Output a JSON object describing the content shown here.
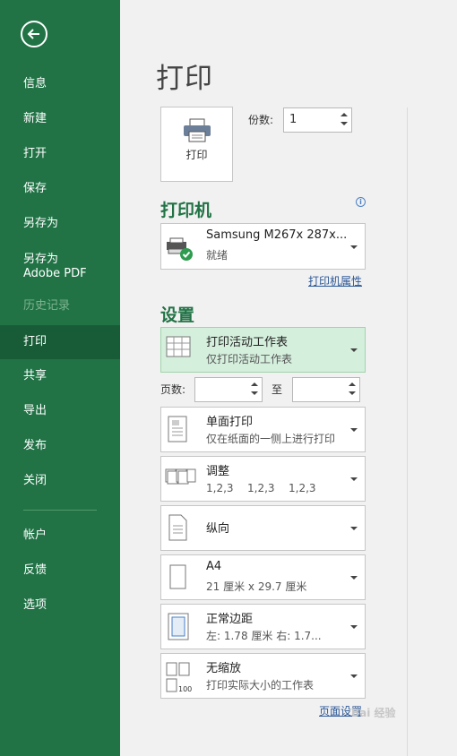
{
  "sidebar": {
    "items": [
      {
        "label": "信息",
        "state": "normal"
      },
      {
        "label": "新建",
        "state": "normal"
      },
      {
        "label": "打开",
        "state": "normal"
      },
      {
        "label": "保存",
        "state": "normal"
      },
      {
        "label": "另存为",
        "state": "normal"
      },
      {
        "label": "另存为 Adobe PDF",
        "state": "normal"
      },
      {
        "label": "历史记录",
        "state": "disabled"
      },
      {
        "label": "打印",
        "state": "active"
      },
      {
        "label": "共享",
        "state": "normal"
      },
      {
        "label": "导出",
        "state": "normal"
      },
      {
        "label": "发布",
        "state": "normal"
      },
      {
        "label": "关闭",
        "state": "normal"
      },
      {
        "label": "帐户",
        "state": "normal"
      },
      {
        "label": "反馈",
        "state": "normal"
      },
      {
        "label": "选项",
        "state": "normal"
      }
    ],
    "bg_color": "#217346",
    "active_color": "#185c37"
  },
  "main": {
    "title": "打印",
    "print_button": "打印",
    "copies_label": "份数:",
    "copies_value": "1"
  },
  "printer": {
    "section_title": "打印机",
    "name": "Samsung M267x 287x...",
    "status": "就绪",
    "properties_link": "打印机属性"
  },
  "settings": {
    "section_title": "设置",
    "scope": {
      "title": "打印活动工作表",
      "subtitle": "仅打印活动工作表"
    },
    "pages_label": "页数:",
    "to_label": "至",
    "sides": {
      "title": "单面打印",
      "subtitle": "仅在纸面的一侧上进行打印"
    },
    "collate": {
      "title": "调整",
      "values": [
        "1,2,3",
        "1,2,3",
        "1,2,3"
      ]
    },
    "orientation": {
      "title": "纵向"
    },
    "paper": {
      "title": "A4",
      "subtitle": "21 厘米 x 29.7 厘米"
    },
    "margins": {
      "title": "正常边距",
      "subtitle": "左: 1.78 厘米    右: 1.7..."
    },
    "scaling": {
      "title": "无缩放",
      "subtitle": "打印实际大小的工作表"
    },
    "page_setup_link": "页面设置"
  },
  "watermark": "Bai 经验",
  "accent": "#217346"
}
